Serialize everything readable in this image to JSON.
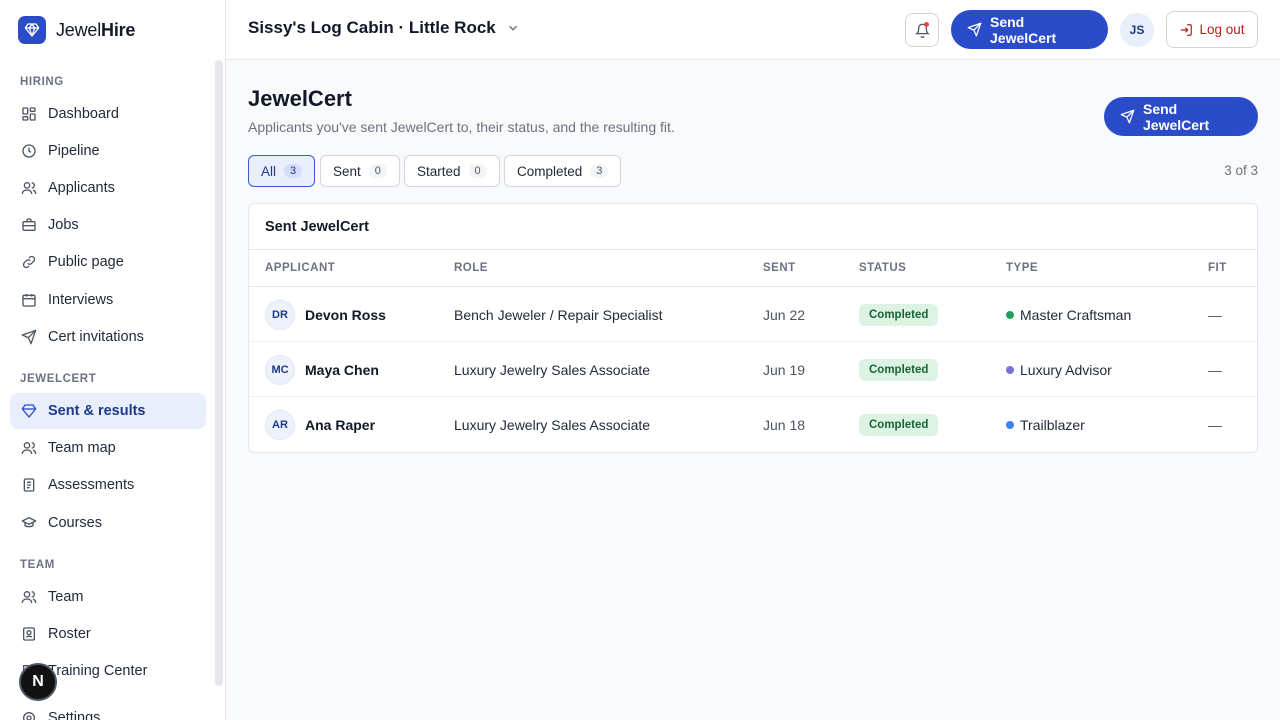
{
  "brand": {
    "name_light": "Jewel",
    "name_bold": "Hire"
  },
  "sidebar": {
    "sections": [
      {
        "label": "HIRING",
        "items": [
          {
            "label": "Dashboard",
            "icon": "dashboard-icon"
          },
          {
            "label": "Pipeline",
            "icon": "clock-icon"
          },
          {
            "label": "Applicants",
            "icon": "users-icon"
          },
          {
            "label": "Jobs",
            "icon": "briefcase-icon"
          },
          {
            "label": "Public page",
            "icon": "link-icon"
          },
          {
            "label": "Interviews",
            "icon": "calendar-icon"
          },
          {
            "label": "Cert invitations",
            "icon": "send-icon"
          }
        ]
      },
      {
        "label": "JEWELCERT",
        "items": [
          {
            "label": "Sent & results",
            "icon": "gem-icon",
            "active": true
          },
          {
            "label": "Team map",
            "icon": "users-icon"
          },
          {
            "label": "Assessments",
            "icon": "clipboard-icon"
          },
          {
            "label": "Courses",
            "icon": "graduation-cap-icon"
          }
        ]
      },
      {
        "label": "TEAM",
        "items": [
          {
            "label": "Team",
            "icon": "users-icon"
          },
          {
            "label": "Roster",
            "icon": "id-badge-icon"
          },
          {
            "label": "Training Center",
            "icon": "book-icon"
          },
          {
            "label": "Settings",
            "icon": "gear-icon"
          }
        ]
      }
    ],
    "fab_label": "N"
  },
  "topbar": {
    "location": "Sissy's Log Cabin · Little Rock",
    "send_label": "Send JewelCert",
    "avatar_initials": "JS",
    "logout_label": "Log out"
  },
  "main": {
    "title": "JewelCert",
    "subtitle": "Applicants you've sent JewelCert to, their status, and the resulting fit.",
    "send_label": "Send JewelCert",
    "tabs": [
      {
        "label": "All",
        "count": "3",
        "active": true
      },
      {
        "label": "Sent",
        "count": "0"
      },
      {
        "label": "Started",
        "count": "0"
      },
      {
        "label": "Completed",
        "count": "3"
      }
    ],
    "count_text": "3 of 3",
    "table": {
      "title": "Sent JewelCert",
      "columns": [
        "APPLICANT",
        "ROLE",
        "SENT",
        "STATUS",
        "TYPE",
        "FIT"
      ],
      "rows": [
        {
          "initials": "DR",
          "name": "Devon Ross",
          "role": "Bench Jeweler / Repair Specialist",
          "sent": "Jun 22",
          "status": "Completed",
          "type": "Master Craftsman",
          "type_color": "#22a05a",
          "fit": "—"
        },
        {
          "initials": "MC",
          "name": "Maya Chen",
          "role": "Luxury Jewelry Sales Associate",
          "sent": "Jun 19",
          "status": "Completed",
          "type": "Luxury Advisor",
          "type_color": "#7c6fe0",
          "fit": "—"
        },
        {
          "initials": "AR",
          "name": "Ana Raper",
          "role": "Luxury Jewelry Sales Associate",
          "sent": "Jun 18",
          "status": "Completed",
          "type": "Trailblazer",
          "type_color": "#3b82f6",
          "fit": "—"
        }
      ]
    }
  },
  "colors": {
    "accent": "#2b4cc8",
    "active_bg": "#e8eefc",
    "success_bg": "#dcf3e4",
    "danger": "#b91c1c"
  }
}
